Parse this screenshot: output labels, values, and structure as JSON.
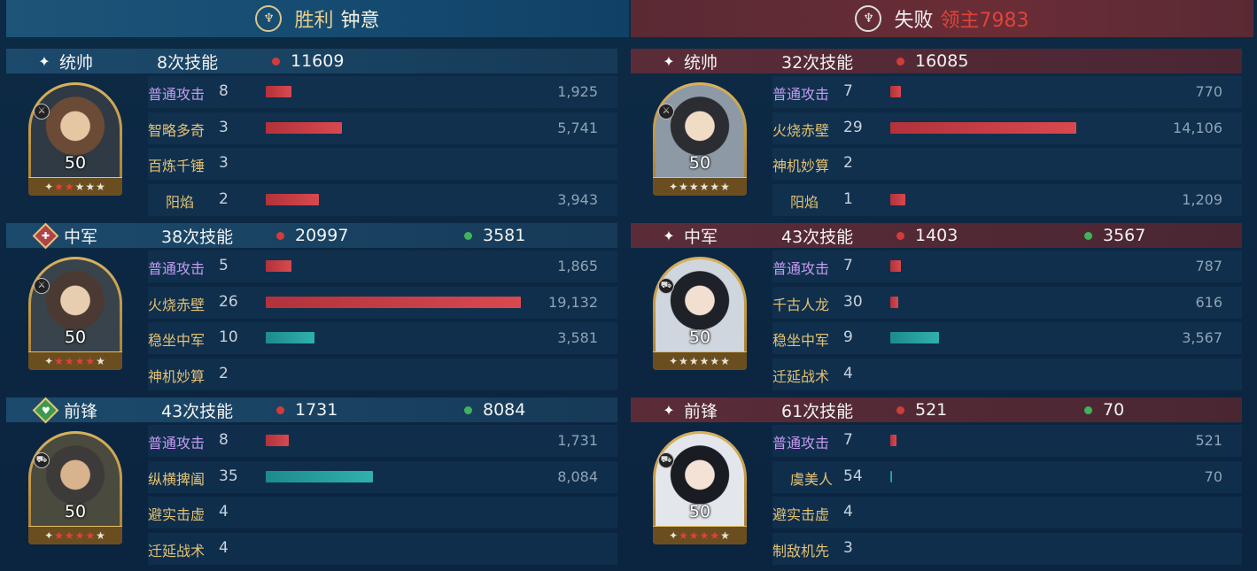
{
  "left": {
    "result": "胜利",
    "player": "钟意",
    "units": [
      {
        "role": "统帅",
        "casts": "8次技能",
        "damage": "11609",
        "heal": "",
        "level": "50",
        "skills": [
          {
            "name": "普通攻击",
            "count": "8",
            "value": "1,925",
            "bar": "red",
            "fraction": 0.1
          },
          {
            "name": "智略多奇",
            "count": "3",
            "value": "5,741",
            "bar": "red",
            "fraction": 0.3
          },
          {
            "name": "百炼千锤",
            "count": "3",
            "value": "",
            "bar": "",
            "fraction": 0
          },
          {
            "name": "阳焰",
            "count": "2",
            "value": "3,943",
            "bar": "red",
            "fraction": 0.21
          }
        ]
      },
      {
        "role": "中军",
        "casts": "38次技能",
        "damage": "20997",
        "heal": "3581",
        "level": "50",
        "skills": [
          {
            "name": "普通攻击",
            "count": "5",
            "value": "1,865",
            "bar": "red",
            "fraction": 0.1
          },
          {
            "name": "火烧赤壁",
            "count": "26",
            "value": "19,132",
            "bar": "red",
            "fraction": 1.0
          },
          {
            "name": "稳坐中军",
            "count": "10",
            "value": "3,581",
            "bar": "teal",
            "fraction": 0.19
          },
          {
            "name": "神机妙算",
            "count": "2",
            "value": "",
            "bar": "",
            "fraction": 0
          }
        ]
      },
      {
        "role": "前锋",
        "casts": "43次技能",
        "damage": "1731",
        "heal": "8084",
        "level": "50",
        "skills": [
          {
            "name": "普通攻击",
            "count": "8",
            "value": "1,731",
            "bar": "red",
            "fraction": 0.09
          },
          {
            "name": "纵横捭阖",
            "count": "35",
            "value": "8,084",
            "bar": "teal",
            "fraction": 0.42
          },
          {
            "name": "避实击虚",
            "count": "4",
            "value": "",
            "bar": "",
            "fraction": 0
          },
          {
            "name": "迁延战术",
            "count": "4",
            "value": "",
            "bar": "",
            "fraction": 0
          }
        ]
      }
    ]
  },
  "right": {
    "result": "失败",
    "player": "领主7983",
    "units": [
      {
        "role": "统帅",
        "casts": "32次技能",
        "damage": "16085",
        "heal": "",
        "level": "50",
        "skills": [
          {
            "name": "普通攻击",
            "count": "7",
            "value": "770",
            "bar": "red",
            "fraction": 0.04
          },
          {
            "name": "火烧赤壁",
            "count": "29",
            "value": "14,106",
            "bar": "red",
            "fraction": 0.73
          },
          {
            "name": "神机妙算",
            "count": "2",
            "value": "",
            "bar": "",
            "fraction": 0
          },
          {
            "name": "阳焰",
            "count": "1",
            "value": "1,209",
            "bar": "red",
            "fraction": 0.06
          }
        ]
      },
      {
        "role": "中军",
        "casts": "43次技能",
        "damage": "1403",
        "heal": "3567",
        "level": "50",
        "skills": [
          {
            "name": "普通攻击",
            "count": "7",
            "value": "787",
            "bar": "red",
            "fraction": 0.04
          },
          {
            "name": "千古人龙",
            "count": "30",
            "value": "616",
            "bar": "red",
            "fraction": 0.03
          },
          {
            "name": "稳坐中军",
            "count": "9",
            "value": "3,567",
            "bar": "teal",
            "fraction": 0.19
          },
          {
            "name": "迁延战术",
            "count": "4",
            "value": "",
            "bar": "",
            "fraction": 0
          }
        ]
      },
      {
        "role": "前锋",
        "casts": "61次技能",
        "damage": "521",
        "heal": "70",
        "level": "50",
        "skills": [
          {
            "name": "普通攻击",
            "count": "7",
            "value": "521",
            "bar": "red",
            "fraction": 0.025
          },
          {
            "name": "虞美人",
            "count": "54",
            "value": "70",
            "bar": "teal",
            "fraction": 0.004
          },
          {
            "name": "避实击虚",
            "count": "4",
            "value": "",
            "bar": "",
            "fraction": 0
          },
          {
            "name": "制敌机先",
            "count": "3",
            "value": "",
            "bar": "",
            "fraction": 0
          }
        ]
      }
    ]
  },
  "colors": {
    "damage": "#d33b3b",
    "heal": "#3fb35a",
    "win_header": "#154a70",
    "lose_header": "#6a2d36"
  },
  "icons": {
    "win_emblem": "laurel-shield-icon",
    "lose_emblem": "broken-shield-icon"
  }
}
